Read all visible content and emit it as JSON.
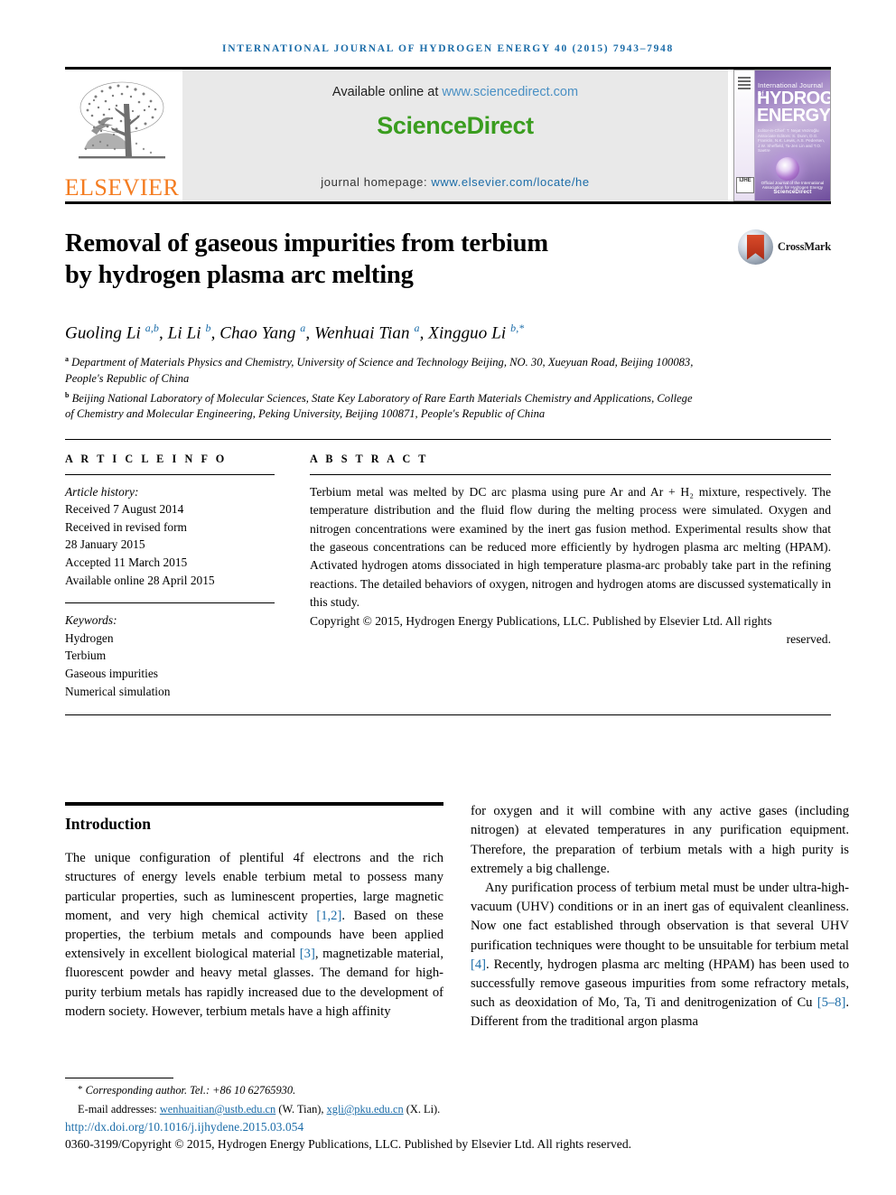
{
  "running_head": "International Journal of Hydrogen Energy 40 (2015) 7943–7948",
  "banner": {
    "publisher_name": "ELSEVIER",
    "available_prefix": "Available online at ",
    "available_url": "www.sciencedirect.com",
    "sciencedirect_logo": "ScienceDirect",
    "homepage_prefix": "journal homepage: ",
    "homepage_url": "www.elsevier.com/locate/he",
    "cover": {
      "line_small": "International Journal of",
      "line_big_1": "HYDROGEN",
      "line_big_2": "ENERGY",
      "editors": "Editor-in-Chief: T. Nejat Veziroğlu\nAssociate Editors: S. Dunn, D.G. Franklin, N.K. Lewis, A.S. Pedersen, J.W. Sheffield, Ta-Jen Lin and T.O. Saetre",
      "footer": "Official Journal of the International Association for Hydrogen Energy",
      "sd_mark": "ScienceDirect",
      "ijhe_mark": "IJHE"
    }
  },
  "article": {
    "title_line_1": "Removal of gaseous impurities from terbium",
    "title_line_2": "by hydrogen plasma arc melting",
    "crossmark_label": "CrossMark",
    "authors_html": "Guoling Li <sup>a,b</sup>, Li Li <sup>b</sup>, Chao Yang <sup>a</sup>, Wenhuai Tian <sup>a</sup>, Xingguo Li <sup>b,*</sup>",
    "affiliation_a": "Department of Materials Physics and Chemistry, University of Science and Technology Beijing, NO. 30, Xueyuan Road, Beijing 100083, People's Republic of China",
    "affiliation_b": "Beijing National Laboratory of Molecular Sciences, State Key Laboratory of Rare Earth Materials Chemistry and Applications, College of Chemistry and Molecular Engineering, Peking University, Beijing 100871, People's Republic of China"
  },
  "article_info": {
    "heading": "A R T I C L E   I N F O",
    "history_label": "Article history:",
    "history": [
      "Received 7 August 2014",
      "Received in revised form",
      "28 January 2015",
      "Accepted 11 March 2015",
      "Available online 28 April 2015"
    ],
    "keywords_label": "Keywords:",
    "keywords": [
      "Hydrogen",
      "Terbium",
      "Gaseous impurities",
      "Numerical simulation"
    ]
  },
  "abstract": {
    "heading": "A B S T R A C T",
    "text": "Terbium metal was melted by DC arc plasma using pure Ar and Ar + H₂ mixture, respectively. The temperature distribution and the fluid flow during the melting process were simulated. Oxygen and nitrogen concentrations were examined by the inert gas fusion method. Experimental results show that the gaseous concentrations can be reduced more efficiently by hydrogen plasma arc melting (HPAM). Activated hydrogen atoms dissociated in high temperature plasma-arc probably take part in the refining reactions. The detailed behaviors of oxygen, nitrogen and hydrogen atoms are discussed systematically in this study.",
    "copyright_main": "Copyright © 2015, Hydrogen Energy Publications, LLC. Published by Elsevier Ltd. All rights",
    "copyright_tail": "reserved."
  },
  "introduction": {
    "heading": "Introduction",
    "col_left_p1_a": "The unique configuration of plentiful 4f electrons and the rich structures of energy levels enable terbium metal to possess many particular properties, such as luminescent properties, large magnetic moment, and very high chemical activity ",
    "col_left_ref1": "[1,2]",
    "col_left_p1_b": ". Based on these properties, the terbium metals and compounds have been applied extensively in excellent biological material ",
    "col_left_ref2": "[3]",
    "col_left_p1_c": ", magnetizable material, fluorescent powder and heavy metal glasses. The demand for high-purity terbium metals has rapidly increased due to the development of modern society. However, terbium metals have a high affinity",
    "col_right_p1": "for oxygen and it will combine with any active gases (including nitrogen) at elevated temperatures in any purification equipment. Therefore, the preparation of terbium metals with a high purity is extremely a big challenge.",
    "col_right_p2_a": "Any purification process of terbium metal must be under ultra-high-vacuum (UHV) conditions or in an inert gas of equivalent cleanliness. Now one fact established through observation is that several UHV purification techniques were thought to be unsuitable for terbium metal ",
    "col_right_ref1": "[4]",
    "col_right_p2_b": ". Recently, hydrogen plasma arc melting (HPAM) has been used to successfully remove gaseous impurities from some refractory metals, such as deoxidation of Mo, Ta, Ti and denitrogenization of Cu ",
    "col_right_ref2": "[5–8]",
    "col_right_p2_c": ". Different from the traditional argon plasma"
  },
  "footnote": {
    "corresponding": "Corresponding author. Tel.: +86 10 62765930.",
    "email_label": "E-mail addresses: ",
    "email_1": "wenhuaitian@ustb.edu.cn",
    "email_1_who": " (W. Tian), ",
    "email_2": "xgli@pku.edu.cn",
    "email_2_who": " (X. Li).",
    "doi": "http://dx.doi.org/10.1016/j.ijhydene.2015.03.054",
    "issn": "0360-3199/Copyright © 2015, Hydrogen Energy Publications, LLC. Published by Elsevier Ltd. All rights reserved."
  },
  "colors": {
    "link_blue": "#1b6ca8",
    "sciencedirect_green": "#3a9d1f",
    "elsevier_orange": "#f47c20",
    "banner_gray": "#e9e9e9"
  }
}
